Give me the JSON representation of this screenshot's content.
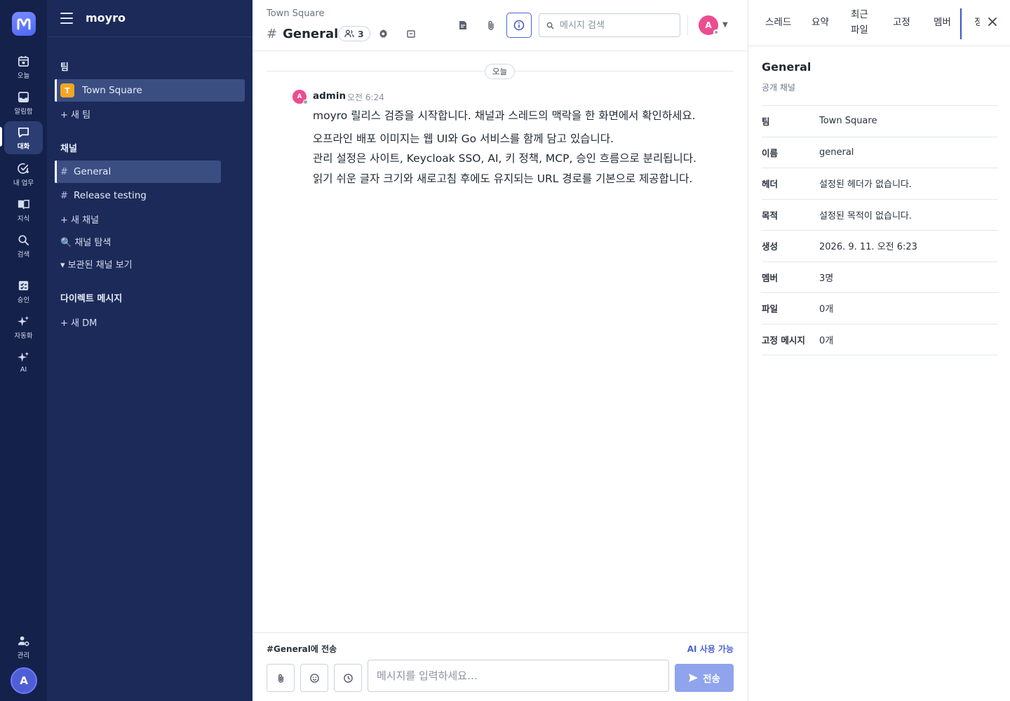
{
  "rail": {
    "items": [
      {
        "label": "오늘",
        "icon": "calendar-icon"
      },
      {
        "label": "알림함",
        "icon": "inbox-icon"
      },
      {
        "label": "대화",
        "icon": "chat-icon"
      },
      {
        "label": "내 업무",
        "icon": "task-check-icon"
      },
      {
        "label": "지식",
        "icon": "book-icon"
      },
      {
        "label": "검색",
        "icon": "search-icon"
      },
      {
        "label": "승인",
        "icon": "approval-icon"
      },
      {
        "label": "자동화",
        "icon": "sparkle-icon"
      },
      {
        "label": "AI",
        "icon": "ai-sparkle-icon"
      }
    ],
    "admin_label": "관리",
    "avatar_initial": "A"
  },
  "sidebar": {
    "brand": "moyro",
    "teams_heading": "팀",
    "team_initial": "T",
    "team_name": "Town Square",
    "new_team": "+ 새 팀",
    "channels_heading": "채널",
    "channels": [
      {
        "name": "General"
      },
      {
        "name": "Release testing"
      }
    ],
    "new_channel": "+ 새 채널",
    "browse_channels": "🔍 채널 탐색",
    "archived_channels": "▾ 보관된 채널 보기",
    "dm_heading": "다이렉트 메시지",
    "new_dm": "+ 새 DM"
  },
  "header": {
    "team": "Town Square",
    "channel_hash": "#",
    "channel": "General",
    "member_count": "3",
    "search_placeholder": "메시지 검색",
    "avatar_initial": "A"
  },
  "messages": {
    "day_divider": "오늘",
    "author": "admin",
    "author_initial": "A",
    "time": "오전 6:24",
    "lines": [
      "moyro 릴리스 검증을 시작합니다. 채널과 스레드의 맥락을 한 화면에서 확인하세요.",
      "오프라인 배포 이미지는 웹 UI와 Go 서비스를 함께 담고 있습니다.",
      "관리 설정은 사이트, Keycloak SSO, AI, 키 정책, MCP, 승인 흐름으로 분리됩니다.",
      "읽기 쉬운 글자 크기와 새로고침 후에도 유지되는 URL 경로를 기본으로 제공합니다."
    ]
  },
  "composer": {
    "label": "#General에 전송",
    "ai_label": "AI 사용 가능",
    "placeholder": "메시지를 입력하세요…",
    "send_label": "전송"
  },
  "right_panel": {
    "tabs": [
      "스레드",
      "요약",
      "최근\n파일",
      "고정",
      "멤버",
      "정"
    ],
    "title": "General",
    "subtitle": "공개 채널",
    "rows": [
      {
        "key": "팀",
        "value": "Town Square"
      },
      {
        "key": "이름",
        "value": "general"
      },
      {
        "key": "헤더",
        "value": "설정된 헤더가 없습니다."
      },
      {
        "key": "목적",
        "value": "설정된 목적이 없습니다."
      },
      {
        "key": "생성",
        "value": "2026. 9. 11. 오전 6:23"
      },
      {
        "key": "멤버",
        "value": "3명"
      },
      {
        "key": "파일",
        "value": "0개"
      },
      {
        "key": "고정 메시지",
        "value": "0개"
      }
    ]
  },
  "colors": {
    "rail_bg": "#14214a",
    "sidebar_bg": "#1b2a59",
    "accent": "#4a63d4",
    "send_button": "#8fa4ec",
    "avatar_pink": "#ec4d8f",
    "team_chip": "#f5a623"
  }
}
